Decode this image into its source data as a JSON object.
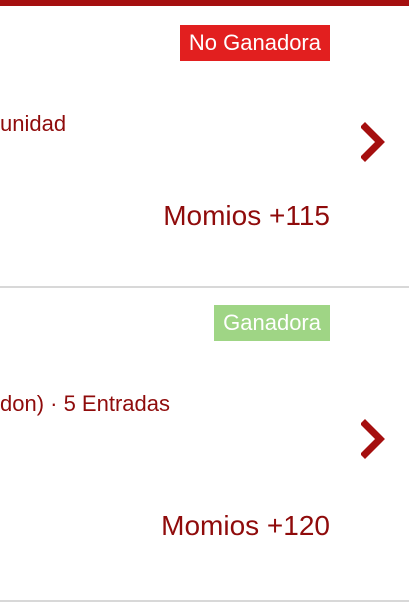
{
  "colors": {
    "accent": "#a50f0f",
    "text": "#8f0b0b",
    "loss_badge": "#e21f1f",
    "win_badge": "#9fd585"
  },
  "bets": [
    {
      "status": "No Ganadora",
      "status_color": "#e21f1f",
      "description": "unidad",
      "odds": "Momios +115",
      "icon": "chevron-right-icon"
    },
    {
      "status": "Ganadora",
      "status_color": "#9fd585",
      "description": "don) · 5 Entradas",
      "odds": "Momios +120",
      "icon": "chevron-right-icon"
    }
  ]
}
